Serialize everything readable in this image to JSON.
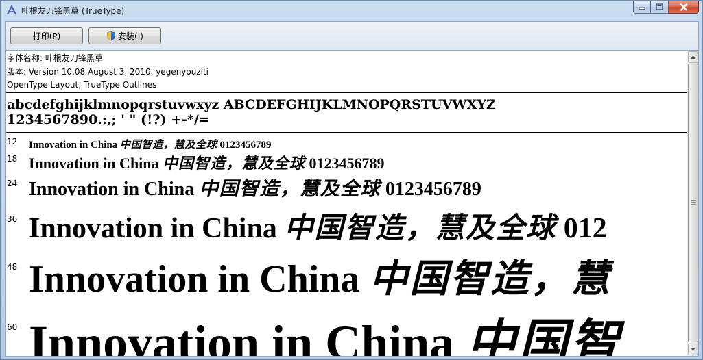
{
  "window": {
    "title": "叶根友刀锋黑草 (TrueType)"
  },
  "icons": {
    "app": "font-app-icon",
    "minimize": "minimize-icon",
    "maximize": "maximize-icon",
    "close": "close-icon",
    "shield": "uac-shield-icon"
  },
  "toolbar": {
    "print_label": "打印(P)",
    "install_label": "安装(I)"
  },
  "info": {
    "font_name": "字体名称: 叶根友刀锋黑草",
    "version": "版本: Version 10.08 August 3, 2010, yegenyouziti",
    "outline_type": "OpenType Layout, TrueType Outlines"
  },
  "charset": {
    "line1": "abcdefghijklmnopqrstuvwxyz ABCDEFGHIJKLMNOPQRSTUVWXYZ",
    "line2": "1234567890.:,; ' \" (!?) +-*/="
  },
  "samples": [
    {
      "size": "12",
      "latin": "Innovation in China ",
      "cjk": "中国智造，慧及全球",
      "digits": " 0123456789"
    },
    {
      "size": "18",
      "latin": "Innovation in China ",
      "cjk": "中国智造，慧及全球",
      "digits": " 0123456789"
    },
    {
      "size": "24",
      "latin": "Innovation in China ",
      "cjk": "中国智造，慧及全球",
      "digits": " 0123456789"
    },
    {
      "size": "36",
      "latin": "Innovation in China ",
      "cjk": "中国智造，慧及全球",
      "digits": " 012"
    },
    {
      "size": "48",
      "latin": "Innovation in China ",
      "cjk": "中国智造，慧",
      "digits": ""
    },
    {
      "size": "60",
      "latin": "Innovation in China ",
      "cjk": "中国智",
      "digits": ""
    }
  ],
  "colors": {
    "title_bar": "#c9dcf0",
    "close_button": "#c7462a",
    "content_bg": "#ffffff"
  }
}
